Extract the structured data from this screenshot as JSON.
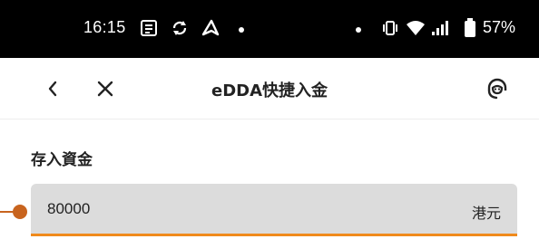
{
  "status_bar": {
    "time": "16:15",
    "battery_percent": "57%",
    "icons": [
      "news-icon",
      "sync-icon",
      "navigation-icon",
      "dot-icon",
      "vibrate-icon",
      "wifi-icon",
      "signal-icon",
      "battery-icon"
    ]
  },
  "header": {
    "title": "eDDA快捷入金",
    "back_icon": "chevron-left-icon",
    "close_icon": "close-icon",
    "support_icon": "customer-service-icon"
  },
  "deposit": {
    "label": "存入資金",
    "amount": "80000",
    "currency": "港元"
  },
  "colors": {
    "accent": "#f08a1c",
    "field_background": "#dcdcdc",
    "annotation": "#c8641e"
  }
}
